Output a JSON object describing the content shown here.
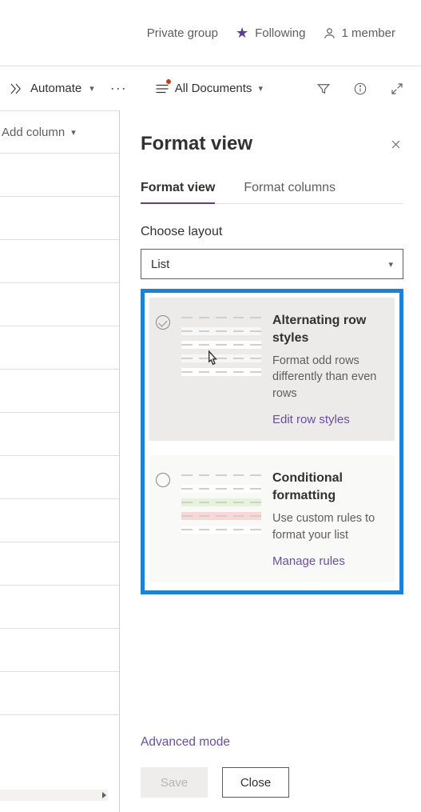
{
  "site_header": {
    "privacy": "Private group",
    "following": "Following",
    "members": "1 member"
  },
  "cmdbar": {
    "automate": "Automate",
    "all_documents": "All Documents"
  },
  "left_col": {
    "add_column": "Add column"
  },
  "panel": {
    "title": "Format view",
    "tabs": {
      "format_view": "Format view",
      "format_columns": "Format columns"
    },
    "choose_layout_label": "Choose layout",
    "layout_value": "List",
    "cards": {
      "alt": {
        "title": "Alternating row styles",
        "desc": "Format odd rows differently than even rows",
        "link": "Edit row styles"
      },
      "cond": {
        "title": "Conditional formatting",
        "desc": "Use custom rules to format your list",
        "link": "Manage rules"
      }
    },
    "advanced_mode": "Advanced mode",
    "buttons": {
      "save": "Save",
      "close": "Close"
    }
  }
}
